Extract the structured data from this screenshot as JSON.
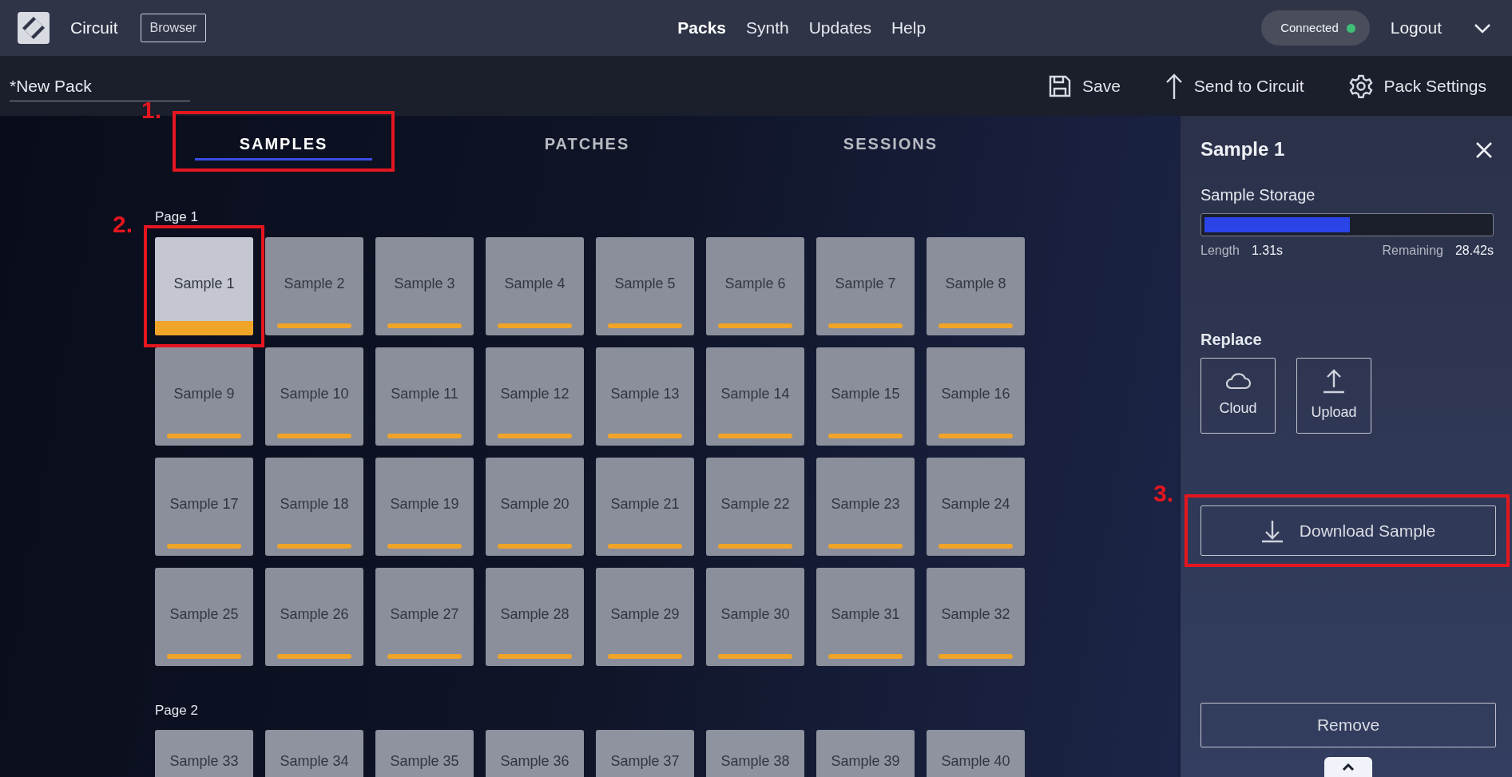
{
  "app": {
    "name": "Circuit",
    "badge": "Browser"
  },
  "nav": [
    {
      "label": "Packs",
      "selected": true
    },
    {
      "label": "Synth",
      "selected": false
    },
    {
      "label": "Updates",
      "selected": false
    },
    {
      "label": "Help",
      "selected": false
    }
  ],
  "status": {
    "label": "Connected",
    "connected": true
  },
  "logout": "Logout",
  "pack": {
    "name": "*New Pack"
  },
  "actions": [
    {
      "kind": "save",
      "label": "Save"
    },
    {
      "kind": "send",
      "label": "Send to Circuit"
    },
    {
      "kind": "settings",
      "label": "Pack Settings"
    }
  ],
  "tabs": [
    {
      "label": "SAMPLES",
      "selected": true
    },
    {
      "label": "PATCHES",
      "selected": false
    },
    {
      "label": "SESSIONS",
      "selected": false
    }
  ],
  "pages": [
    {
      "title": "Page 1",
      "samples": [
        {
          "label": "Sample 1",
          "selected": true
        },
        {
          "label": "Sample 2",
          "selected": false
        },
        {
          "label": "Sample 3",
          "selected": false
        },
        {
          "label": "Sample 4",
          "selected": false
        },
        {
          "label": "Sample 5",
          "selected": false
        },
        {
          "label": "Sample 6",
          "selected": false
        },
        {
          "label": "Sample 7",
          "selected": false
        },
        {
          "label": "Sample 8",
          "selected": false
        },
        {
          "label": "Sample 9",
          "selected": false
        },
        {
          "label": "Sample 10",
          "selected": false
        },
        {
          "label": "Sample 11",
          "selected": false
        },
        {
          "label": "Sample 12",
          "selected": false
        },
        {
          "label": "Sample 13",
          "selected": false
        },
        {
          "label": "Sample 14",
          "selected": false
        },
        {
          "label": "Sample 15",
          "selected": false
        },
        {
          "label": "Sample 16",
          "selected": false
        },
        {
          "label": "Sample 17",
          "selected": false
        },
        {
          "label": "Sample 18",
          "selected": false
        },
        {
          "label": "Sample 19",
          "selected": false
        },
        {
          "label": "Sample 20",
          "selected": false
        },
        {
          "label": "Sample 21",
          "selected": false
        },
        {
          "label": "Sample 22",
          "selected": false
        },
        {
          "label": "Sample 23",
          "selected": false
        },
        {
          "label": "Sample 24",
          "selected": false
        },
        {
          "label": "Sample 25",
          "selected": false
        },
        {
          "label": "Sample 26",
          "selected": false
        },
        {
          "label": "Sample 27",
          "selected": false
        },
        {
          "label": "Sample 28",
          "selected": false
        },
        {
          "label": "Sample 29",
          "selected": false
        },
        {
          "label": "Sample 30",
          "selected": false
        },
        {
          "label": "Sample 31",
          "selected": false
        },
        {
          "label": "Sample 32",
          "selected": false
        }
      ]
    },
    {
      "title": "Page 2",
      "samples": [
        {
          "label": "Sample 33",
          "selected": false
        },
        {
          "label": "Sample 34",
          "selected": false
        },
        {
          "label": "Sample 35",
          "selected": false
        },
        {
          "label": "Sample 36",
          "selected": false
        },
        {
          "label": "Sample 37",
          "selected": false
        },
        {
          "label": "Sample 38",
          "selected": false
        },
        {
          "label": "Sample 39",
          "selected": false
        },
        {
          "label": "Sample 40",
          "selected": false
        }
      ]
    }
  ],
  "panel": {
    "title": "Sample 1",
    "storage": {
      "label": "Sample Storage",
      "level": 0.51,
      "length_label": "Length",
      "length": "1.31s",
      "remaining_label": "Remaining",
      "remaining": "28.42s"
    },
    "replace": {
      "title": "Replace",
      "options": [
        {
          "kind": "cloud",
          "label": "Cloud"
        },
        {
          "kind": "upload",
          "label": "Upload"
        }
      ]
    },
    "download": "Download Sample",
    "remove": "Remove"
  },
  "annotations": [
    {
      "kind": "tab",
      "label": "1."
    },
    {
      "kind": "tile",
      "label": "2."
    },
    {
      "kind": "download",
      "label": "3."
    }
  ]
}
